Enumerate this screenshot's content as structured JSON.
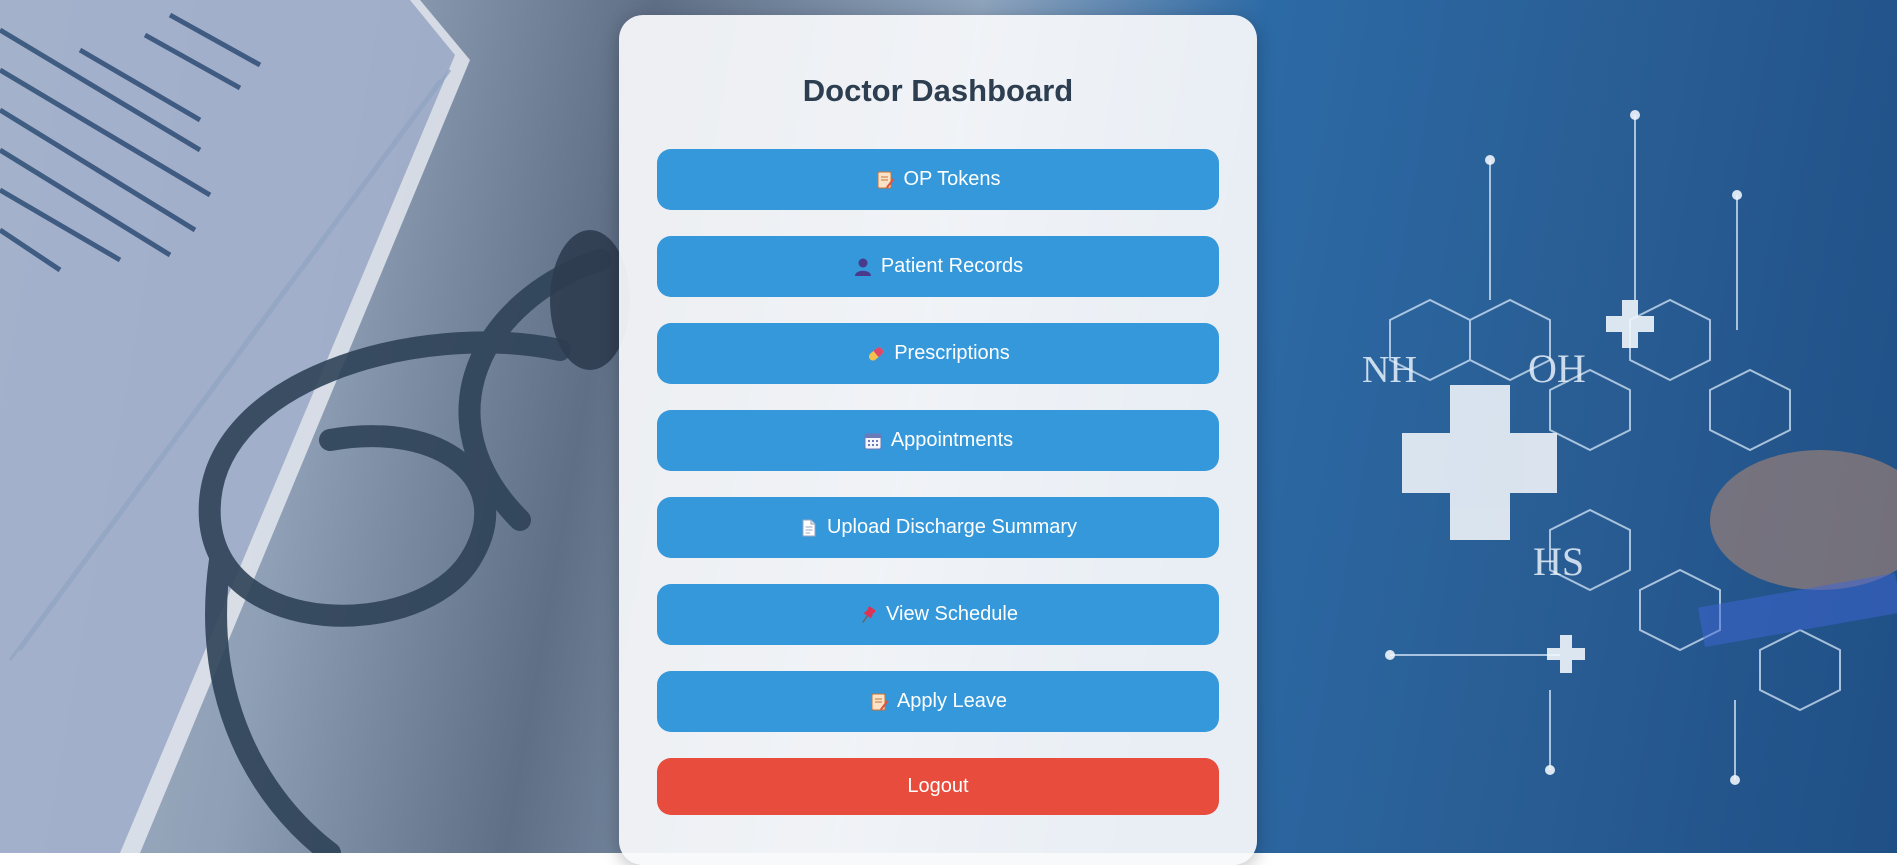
{
  "page": {
    "title": "Doctor Dashboard"
  },
  "menu": [
    {
      "name": "op-tokens-button",
      "icon": "memo-icon",
      "label": "OP Tokens"
    },
    {
      "name": "patient-records-button",
      "icon": "person-icon",
      "label": "Patient Records"
    },
    {
      "name": "prescriptions-button",
      "icon": "pill-icon",
      "label": "Prescriptions"
    },
    {
      "name": "appointments-button",
      "icon": "calendar-icon",
      "label": "Appointments"
    },
    {
      "name": "upload-discharge-summary-button",
      "icon": "document-icon",
      "label": "Upload Discharge Summary"
    },
    {
      "name": "view-schedule-button",
      "icon": "pushpin-icon",
      "label": "View Schedule"
    },
    {
      "name": "apply-leave-button",
      "icon": "memo-icon",
      "label": "Apply Leave"
    }
  ],
  "logout": {
    "label": "Logout"
  },
  "colors": {
    "primary_button": "#3498db",
    "logout_button": "#e74c3c",
    "title_text": "#2c3e50"
  }
}
